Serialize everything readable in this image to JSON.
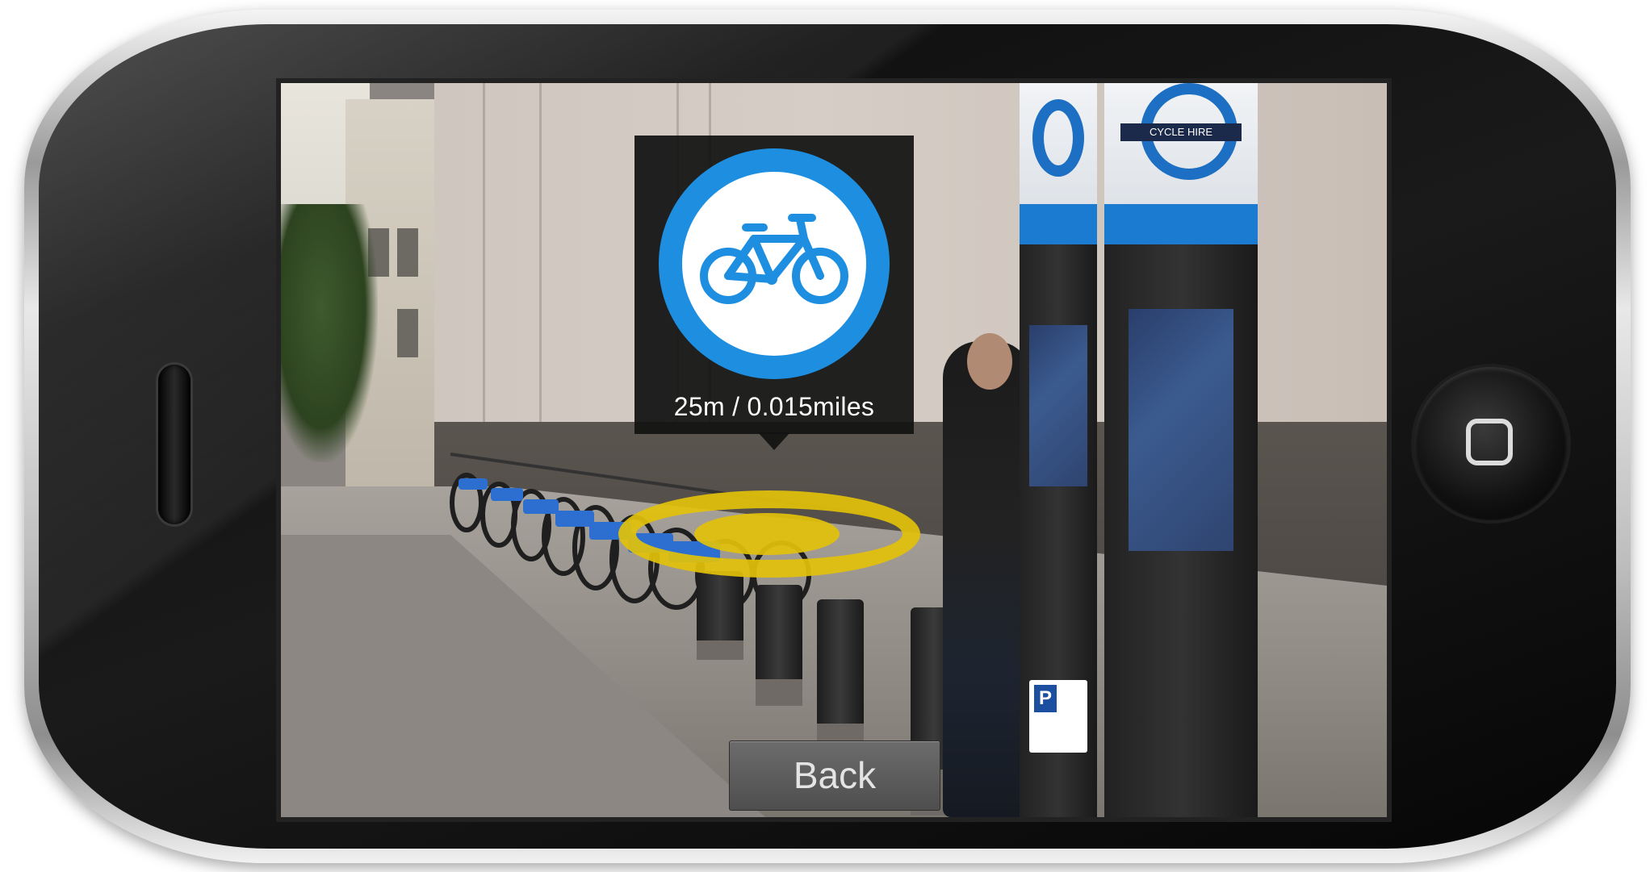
{
  "device": {
    "type": "smartphone-landscape",
    "home_button_icon": "home-square-icon"
  },
  "ar_view": {
    "poi": {
      "icon": "bicycle-icon",
      "icon_color": "#1e8fe0",
      "distance_label": "25m / 0.015miles",
      "ground_marker_color": "#e2c10a"
    },
    "kiosk_sign": "CYCLE HIRE"
  },
  "controls": {
    "back_label": "Back"
  }
}
